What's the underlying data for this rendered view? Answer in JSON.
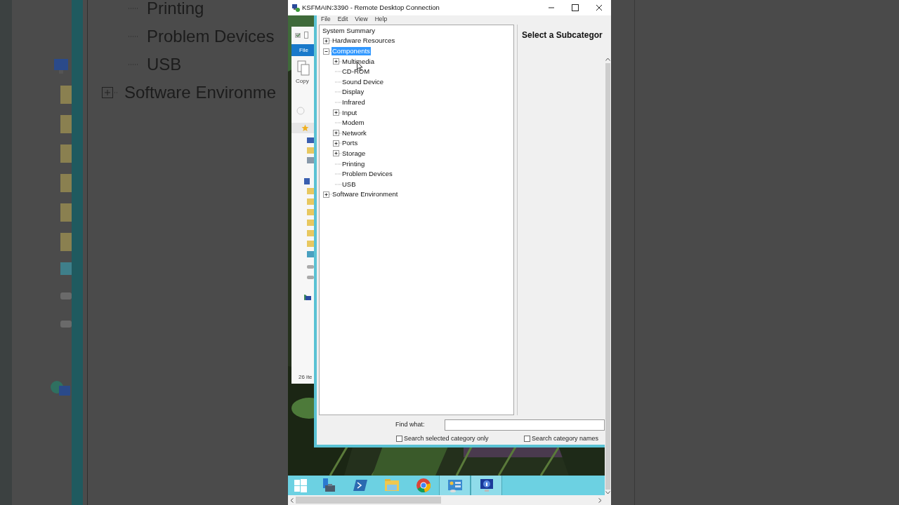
{
  "backdrop_left": {
    "tree_items": [
      {
        "label": "Printing",
        "expandable": false
      },
      {
        "label": "Problem Devices",
        "expandable": false
      },
      {
        "label": "USB",
        "expandable": false
      },
      {
        "label": "Software Environme",
        "expandable": true
      }
    ]
  },
  "window": {
    "title": "KSFMAIN:3390 - Remote Desktop Connection"
  },
  "explorer": {
    "ribbon_tab": "File",
    "copy_label": "Copy",
    "status": "26 ite"
  },
  "msinfo": {
    "menu": [
      "File",
      "Edit",
      "View",
      "Help"
    ],
    "tree": [
      {
        "label": "System Summary",
        "selected": false,
        "children": [
          {
            "label": "Hardware Resources",
            "expanded": false,
            "selected": false
          },
          {
            "label": "Components",
            "expanded": true,
            "selected": true,
            "children": [
              {
                "label": "Multimedia",
                "expanded": false,
                "selected": false
              },
              {
                "label": "CD-ROM",
                "selected": false
              },
              {
                "label": "Sound Device",
                "selected": false
              },
              {
                "label": "Display",
                "selected": false
              },
              {
                "label": "Infrared",
                "selected": false
              },
              {
                "label": "Input",
                "expanded": false,
                "selected": false
              },
              {
                "label": "Modem",
                "selected": false
              },
              {
                "label": "Network",
                "expanded": false,
                "selected": false
              },
              {
                "label": "Ports",
                "expanded": false,
                "selected": false
              },
              {
                "label": "Storage",
                "expanded": false,
                "selected": false
              },
              {
                "label": "Printing",
                "selected": false
              },
              {
                "label": "Problem Devices",
                "selected": false
              },
              {
                "label": "USB",
                "selected": false
              }
            ]
          },
          {
            "label": "Software Environment",
            "expanded": false,
            "selected": false
          }
        ]
      }
    ],
    "detail_heading": "Select a Subcategor",
    "find_label": "Find what:",
    "checkboxes": [
      {
        "label": "Search selected category only",
        "checked": false
      },
      {
        "label": "Search category names",
        "checked": false
      }
    ]
  },
  "taskbar": {
    "apps": [
      {
        "kind": "start",
        "open": false
      },
      {
        "kind": "server",
        "open": false
      },
      {
        "kind": "shell",
        "open": false
      },
      {
        "kind": "folder",
        "open": false
      },
      {
        "kind": "browser",
        "open": false
      },
      {
        "kind": "panel",
        "open": true
      },
      {
        "kind": "sysinfo",
        "open": true
      }
    ]
  }
}
